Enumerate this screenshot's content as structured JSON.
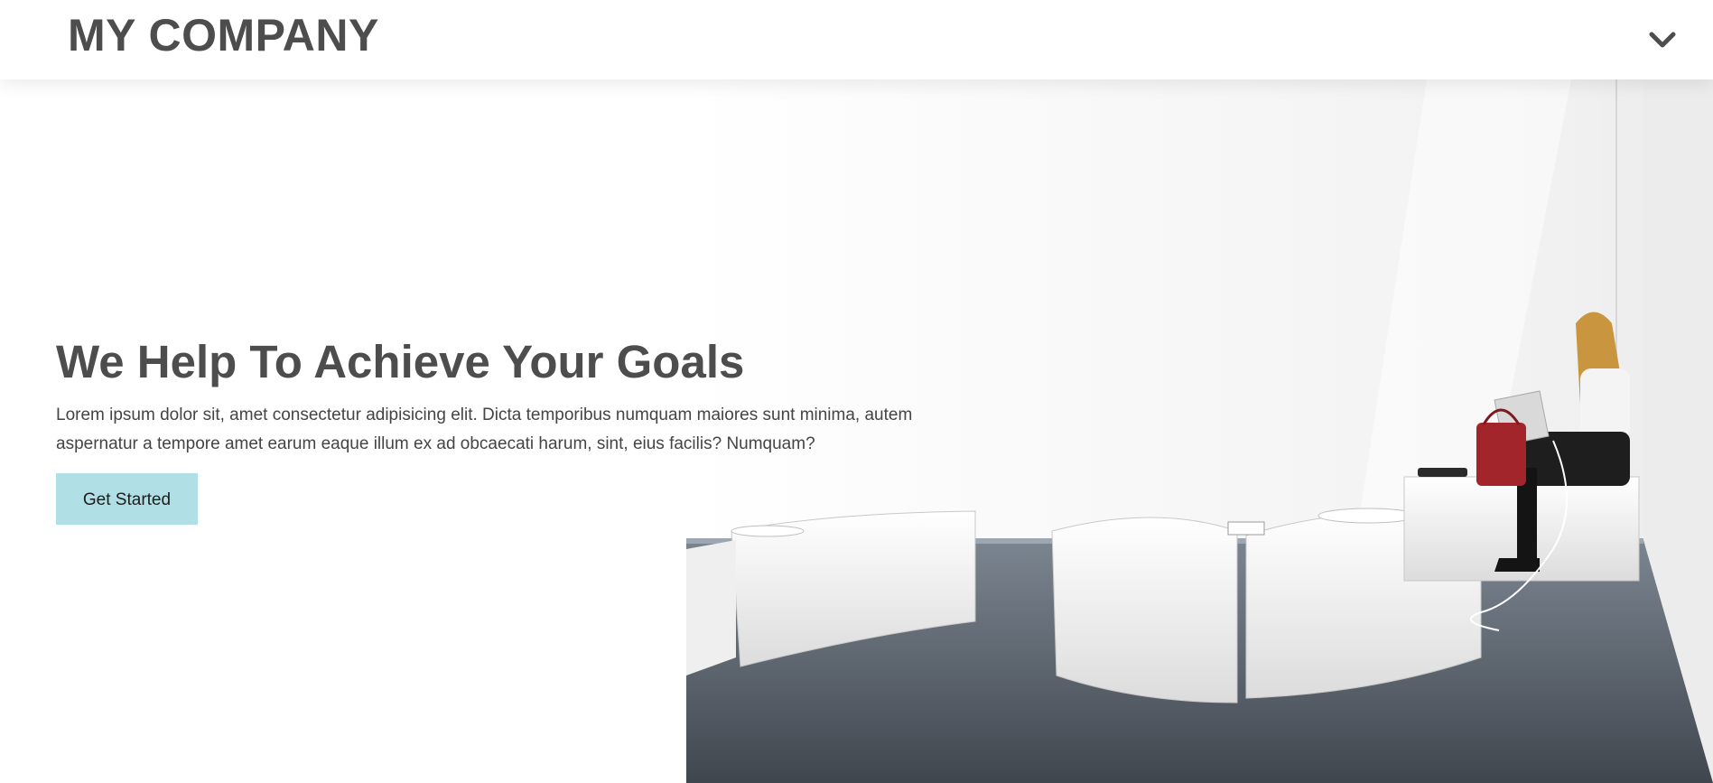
{
  "navbar": {
    "brand": "MY COMPANY",
    "toggle_icon": "chevron-down-icon"
  },
  "hero": {
    "headline": "We Help To Achieve Your Goals",
    "paragraph": "Lorem ipsum dolor sit, amet consectetur adipisicing elit. Dicta temporibus numquam maiores sunt minima, autem aspernatur a tempore amet earum eaque illum ex ad obcaecati harum, sint, eius facilis? Numquam?",
    "cta_label": "Get Started",
    "image": "office-lounge-photo"
  },
  "colors": {
    "cta_background": "#b0dfe5",
    "text": "#4d4d4d",
    "background": "#ffffff"
  }
}
